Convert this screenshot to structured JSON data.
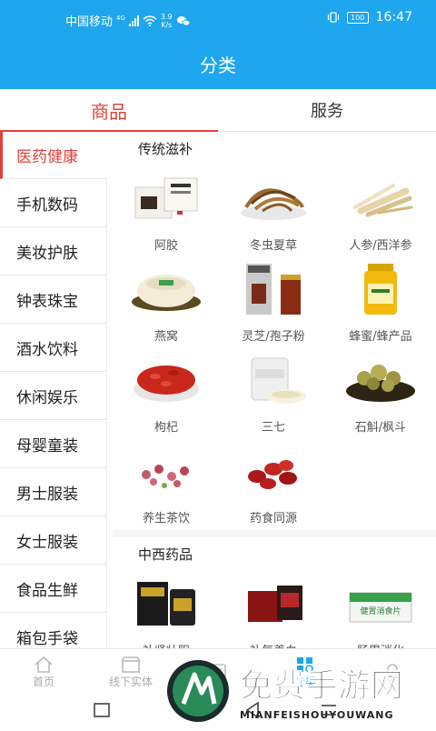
{
  "status": {
    "carrier": "中国移动",
    "net": "4G",
    "speed_val": "3.9",
    "speed_unit": "K/s",
    "battery": "100",
    "time": "16:47"
  },
  "title": "分类",
  "tabs": [
    {
      "label": "商品",
      "active": true
    },
    {
      "label": "服务",
      "active": false
    }
  ],
  "sidebar": [
    {
      "label": "医药健康",
      "active": true
    },
    {
      "label": "手机数码"
    },
    {
      "label": "美妆护肤"
    },
    {
      "label": "钟表珠宝"
    },
    {
      "label": "酒水饮料"
    },
    {
      "label": "休闲娱乐"
    },
    {
      "label": "母婴童装"
    },
    {
      "label": "男士服装"
    },
    {
      "label": "女士服装"
    },
    {
      "label": "食品生鲜"
    },
    {
      "label": "箱包手袋"
    }
  ],
  "sections": [
    {
      "title": "传统滋补",
      "items": [
        {
          "label": "阿胶",
          "icon": "ejiao-box-icon"
        },
        {
          "label": "冬虫夏草",
          "icon": "cordyceps-icon"
        },
        {
          "label": "人参/西洋参",
          "icon": "ginseng-icon"
        },
        {
          "label": "燕窝",
          "icon": "birdnest-icon"
        },
        {
          "label": "灵芝/孢子粉",
          "icon": "lingzhi-jar-icon"
        },
        {
          "label": "蜂蜜/蜂产品",
          "icon": "honey-jar-icon"
        },
        {
          "label": "枸杞",
          "icon": "goji-bowl-icon"
        },
        {
          "label": "三七",
          "icon": "sanqi-jar-icon"
        },
        {
          "label": "石斛/枫斗",
          "icon": "dendrobium-bowl-icon"
        },
        {
          "label": "养生茶饮",
          "icon": "flower-tea-icon"
        },
        {
          "label": "药食同源",
          "icon": "red-dates-icon"
        }
      ]
    },
    {
      "title": "中西药品",
      "items": [
        {
          "label": "补肾壮阳",
          "icon": "medicine-box-icon"
        },
        {
          "label": "补气养血",
          "icon": "medicine-box-icon"
        },
        {
          "label": "肠胃消化",
          "icon": "medicine-box-icon",
          "box_text": "健胃消食片"
        }
      ]
    }
  ],
  "bottom_nav": [
    {
      "label": "首页",
      "icon": "home-icon"
    },
    {
      "label": "线下实体",
      "icon": "store-icon"
    },
    {
      "label": "",
      "icon": "news-icon"
    },
    {
      "label": "分类",
      "icon": "category-icon",
      "active": true
    },
    {
      "label": "",
      "icon": "user-icon"
    }
  ],
  "watermark": {
    "title": "免费手游网",
    "subtitle": "MIANFEISHOUYOUWANG"
  },
  "colors": {
    "primary": "#1ea6ee",
    "accent": "#e0423a"
  }
}
